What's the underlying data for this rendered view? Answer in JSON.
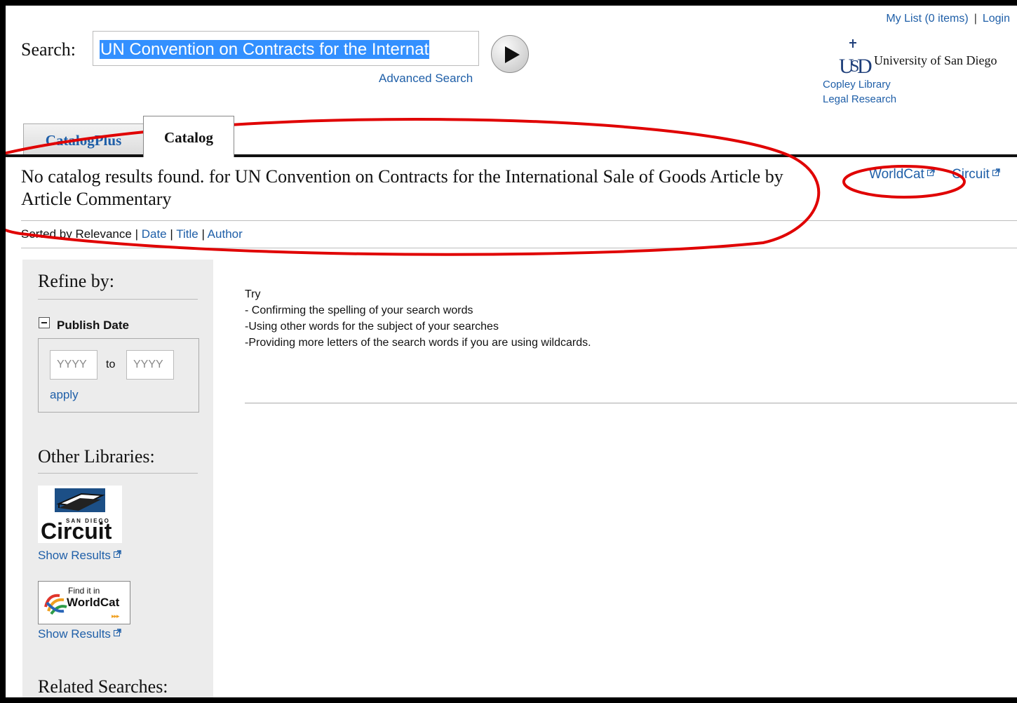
{
  "header": {
    "my_list": "My List (0 items)",
    "separator": "|",
    "login": "Login",
    "search_label": "Search:",
    "search_value": "UN Convention on Contracts for the Internat",
    "advanced_search": "Advanced Search",
    "university": "University of San Diego",
    "copley_library": "Copley Library",
    "legal_research": "Legal Research"
  },
  "tabs": [
    {
      "label": "CatalogPlus"
    },
    {
      "label": "Catalog"
    }
  ],
  "results": {
    "title": "No catalog results found. for UN Convention on Contracts for the International Sale of Goods Article by Article Commentary",
    "worldcat_link": "WorldCat",
    "circuit_link": "Circuit"
  },
  "sort": {
    "prefix": "Sorted by",
    "relevance": "Relevance",
    "sep": "|",
    "date": "Date",
    "title": "Title",
    "author": "Author"
  },
  "sidebar": {
    "refine_heading": "Refine by:",
    "publish_date_label": "Publish Date",
    "from_placeholder": "YYYY",
    "to_placeholder": "YYYY",
    "to_word": "to",
    "apply": "apply",
    "other_libraries_heading": "Other Libraries:",
    "circuit_logo_small": "SAN DIEGO",
    "circuit_logo_text": "Circuit",
    "worldcat_logo_line1": "Find it in",
    "worldcat_logo_line2": "WorldCat",
    "show_results_1": "Show Results",
    "show_results_2": "Show Results",
    "related_heading": "Related Searches:"
  },
  "suggestions": {
    "try": "Try",
    "line1": "- Confirming the spelling of your search words",
    "line2": "-Using other words for the subject of your searches",
    "line3": "-Providing more letters of the search words if you are using wildcards."
  },
  "colors": {
    "link": "#1f5fa8",
    "selection": "#3390ff",
    "annotation": "#e00000",
    "sidebar_bg": "#ececec"
  }
}
